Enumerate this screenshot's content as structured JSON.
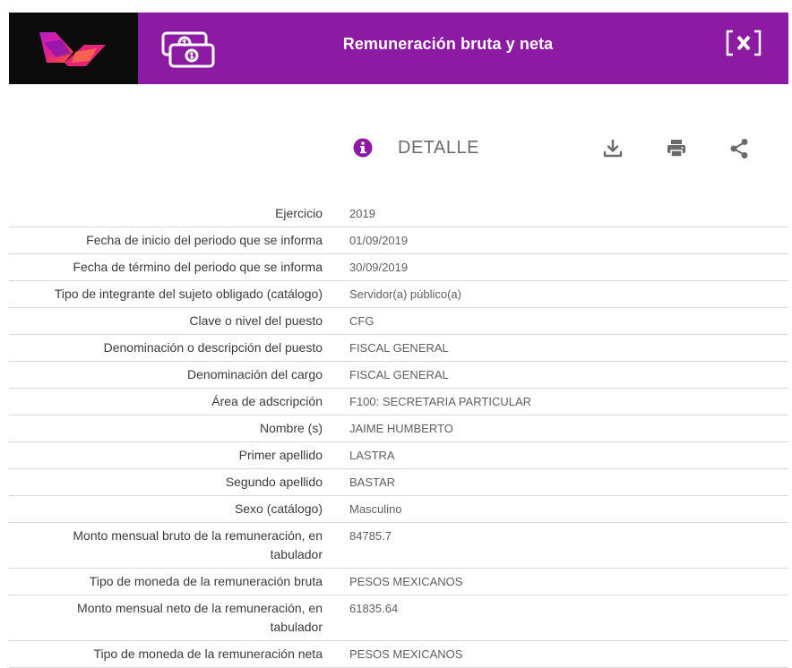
{
  "header": {
    "title": "Remuneración bruta y neta"
  },
  "toolbar": {
    "detail_label": "DETALLE"
  },
  "rows": [
    {
      "label": "Ejercicio",
      "value": "2019"
    },
    {
      "label": "Fecha de inicio del periodo que se informa",
      "value": "01/09/2019"
    },
    {
      "label": "Fecha de término del periodo que se informa",
      "value": "30/09/2019"
    },
    {
      "label": "Tipo de integrante del sujeto obligado (catálogo)",
      "value": "Servidor(a) público(a)"
    },
    {
      "label": "Clave o nivel del puesto",
      "value": "CFG"
    },
    {
      "label": "Denominación o descripción del puesto",
      "value": "FISCAL GENERAL"
    },
    {
      "label": "Denominación del cargo",
      "value": "FISCAL GENERAL"
    },
    {
      "label": "Área de adscripción",
      "value": "F100: SECRETARIA PARTICULAR"
    },
    {
      "label": "Nombre (s)",
      "value": "JAIME HUMBERTO"
    },
    {
      "label": "Primer apellido",
      "value": "LASTRA"
    },
    {
      "label": "Segundo apellido",
      "value": "BASTAR"
    },
    {
      "label": "Sexo (catálogo)",
      "value": "Masculino"
    },
    {
      "label": "Monto mensual bruto de la remuneración, en tabulador",
      "value": "84785.7"
    },
    {
      "label": "Tipo de moneda de la remuneración bruta",
      "value": "PESOS MEXICANOS"
    },
    {
      "label": "Monto mensual neto de la remuneración, en tabulador",
      "value": "61835.64"
    },
    {
      "label": "Tipo de moneda de la remuneración neta",
      "value": "PESOS MEXICANOS"
    }
  ],
  "colors": {
    "header_bg": "#8c1aa3",
    "logo_bg": "#0b0b0b",
    "accent": "#8c1aa3"
  },
  "icons": [
    "logo",
    "money-icon",
    "close-icon",
    "info-icon",
    "download-icon",
    "print-icon",
    "share-icon"
  ]
}
